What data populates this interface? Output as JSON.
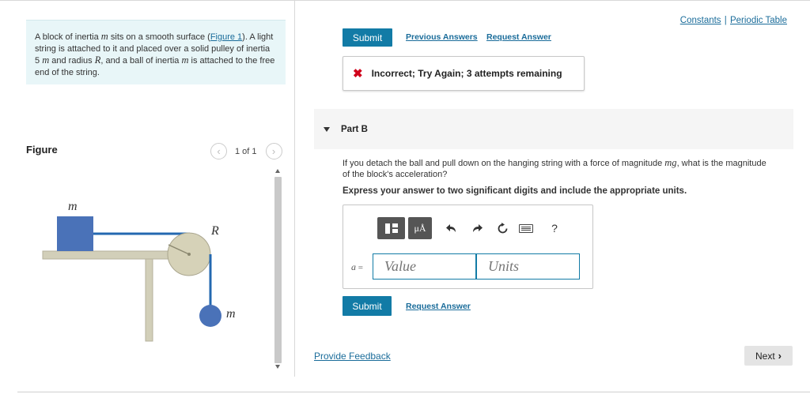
{
  "problem": {
    "intro_parts": {
      "p1": "A block of inertia ",
      "m1": "m",
      "p2": " sits on a smooth surface (",
      "link": "Figure 1",
      "p3": "). A light string is attached to it and placed over a solid pulley of inertia 5 ",
      "m2": "m",
      "p4": " and radius ",
      "r": "R",
      "p5": ", and a ball of inertia ",
      "m3": "m",
      "p6": " is attached to the free end of the string."
    }
  },
  "figure": {
    "title": "Figure",
    "pager_text": "1 of 1",
    "prev_icon": "chevron-left-icon",
    "next_icon": "chevron-right-icon",
    "labels": {
      "block": "m",
      "pulley": "R",
      "ball": "m"
    },
    "colors": {
      "block": "#4a72b8",
      "ball": "#4a72b8",
      "string": "#2468b0",
      "pulley": "#d6d2b8",
      "table": "#d2cfb9",
      "table_edge": "#b5b29c"
    }
  },
  "header_links": {
    "constants": "Constants",
    "separator": "|",
    "periodic": "Periodic Table"
  },
  "previous_part": {
    "submit": "Submit",
    "previous_answers": "Previous Answers",
    "request_answer": "Request Answer",
    "feedback_icon": "x-icon",
    "feedback_symbol": "✖",
    "feedback": "Incorrect; Try Again; 3 attempts remaining"
  },
  "part_b": {
    "label": "Part B",
    "question_p1": "If you detach the ball and pull down on the hanging string with a force of magnitude ",
    "question_mg": "mg",
    "question_p2": ", what is the magnitude of the block's acceleration?",
    "instruction": "Express your answer to two significant digits and include the appropriate units.",
    "toolbar": {
      "templates_icon": "templates-icon",
      "units_label": "μÅ",
      "undo_icon": "undo-icon",
      "redo_icon": "redo-icon",
      "reset_icon": "reset-icon",
      "keyboard_icon": "keyboard-icon",
      "help_label": "?"
    },
    "answer_var": "a",
    "answer_eq": " =",
    "value_placeholder": "Value",
    "units_placeholder": "Units",
    "submit": "Submit",
    "request_answer": "Request Answer"
  },
  "footer": {
    "provide_feedback": "Provide Feedback",
    "next": "Next",
    "next_icon": "chevron-right-icon"
  }
}
